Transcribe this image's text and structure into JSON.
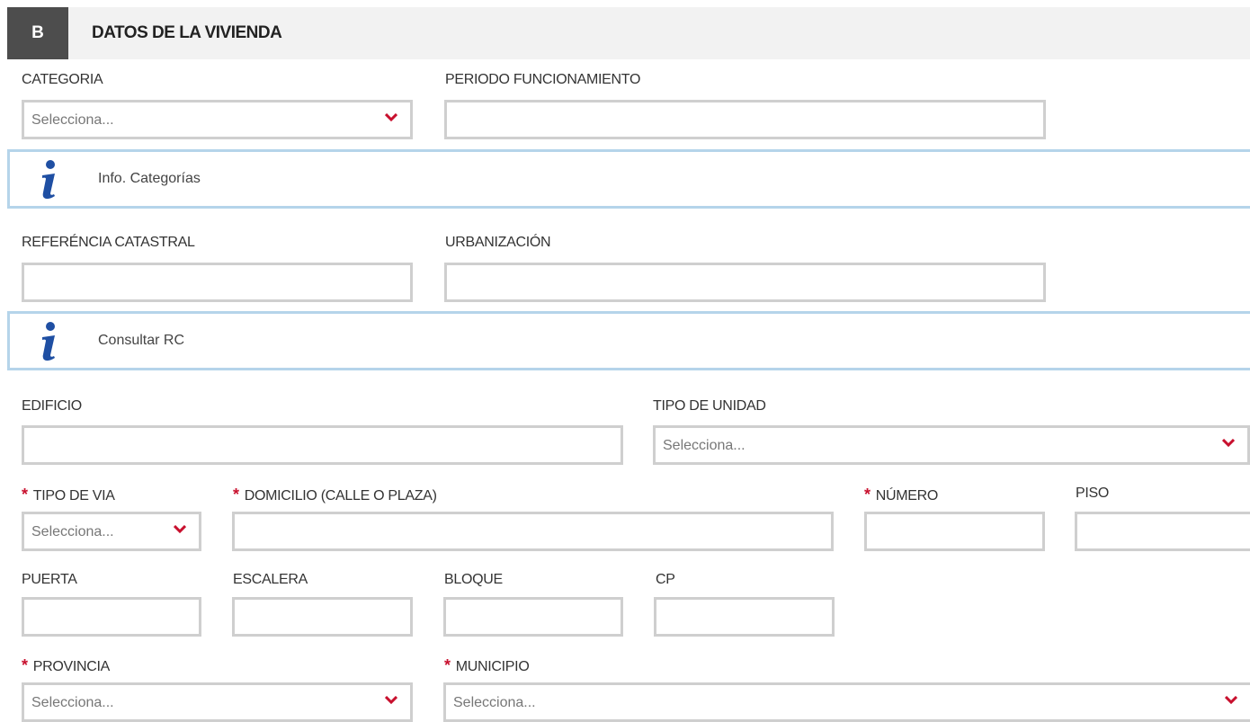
{
  "section": {
    "badge": "B",
    "title": "DATOS DE LA VIVIENDA"
  },
  "colors": {
    "required": "#c8102e",
    "info_border": "#b5d4ea",
    "info_icon": "#1f4fa3",
    "field_border": "#cfcfcf"
  },
  "fields": {
    "categoria": {
      "label": "CATEGORIA",
      "value": "Selecciona..."
    },
    "periodo": {
      "label": "PERIODO FUNCIONAMIENTO",
      "value": ""
    },
    "referencia": {
      "label": "REFERÉNCIA CATASTRAL",
      "value": ""
    },
    "urbanizacion": {
      "label": "URBANIZACIÓN",
      "value": ""
    },
    "edificio": {
      "label": "EDIFICIO",
      "value": ""
    },
    "tipo_unidad": {
      "label": "TIPO DE UNIDAD",
      "value": "Selecciona..."
    },
    "tipo_via": {
      "label": "TIPO DE VIA",
      "value": "Selecciona...",
      "required": true
    },
    "domicilio": {
      "label": "DOMICILIO (CALLE O PLAZA)",
      "value": "",
      "required": true
    },
    "numero": {
      "label": "NÚMERO",
      "value": "",
      "required": true
    },
    "piso": {
      "label": "PISO",
      "value": ""
    },
    "puerta": {
      "label": "PUERTA",
      "value": ""
    },
    "escalera": {
      "label": "ESCALERA",
      "value": ""
    },
    "bloque": {
      "label": "BLOQUE",
      "value": ""
    },
    "cp": {
      "label": "CP",
      "value": ""
    },
    "provincia": {
      "label": "PROVINCIA",
      "value": "Selecciona...",
      "required": true
    },
    "municipio": {
      "label": "MUNICIPIO",
      "value": "Selecciona...",
      "required": true
    }
  },
  "info_boxes": {
    "categorias": {
      "icon": "info-icon",
      "text": "Info. Categorías"
    },
    "consultar_rc": {
      "icon": "info-icon",
      "text": "Consultar RC"
    }
  },
  "required_mark": "*"
}
